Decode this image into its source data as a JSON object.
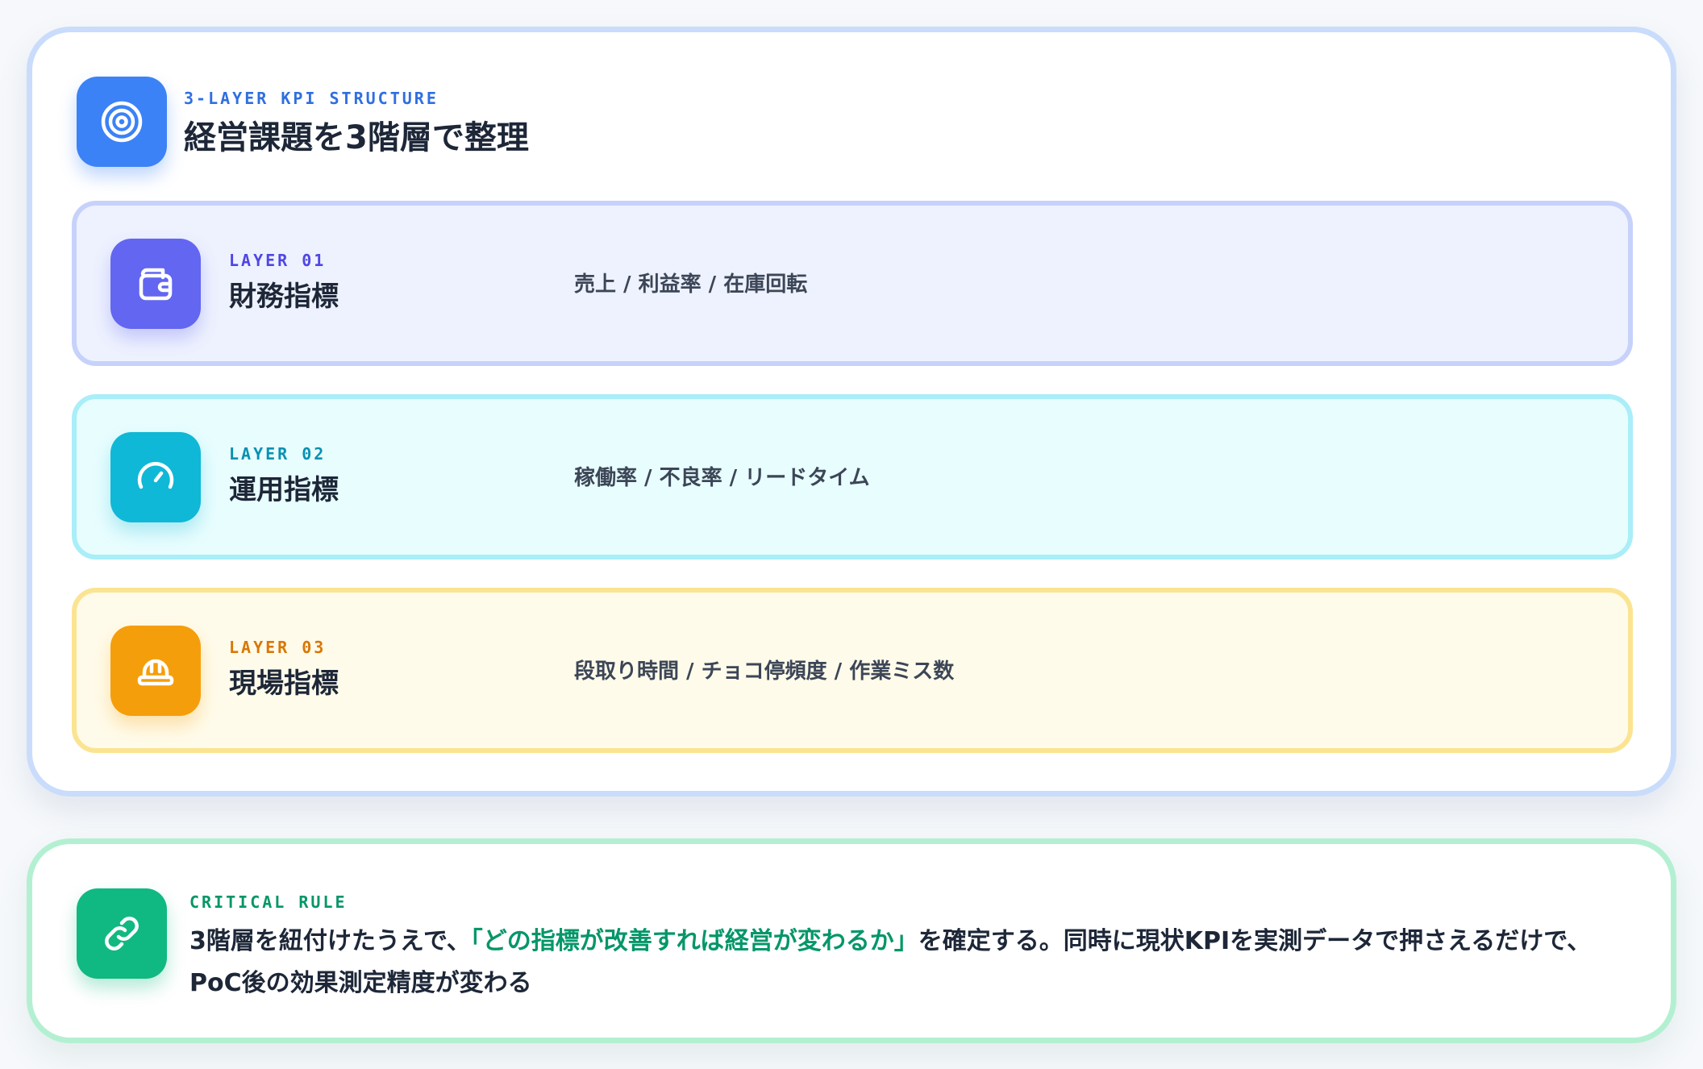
{
  "structure": {
    "eyebrow": "3-LAYER KPI STRUCTURE",
    "title": "経営課題を3階層で整理",
    "icon": "target-icon"
  },
  "layers": [
    {
      "eyebrow": "LAYER 01",
      "name": "財務指標",
      "metrics": "売上 / 利益率 / 在庫回転",
      "icon": "wallet-icon",
      "accent": "#6366f1"
    },
    {
      "eyebrow": "LAYER 02",
      "name": "運用指標",
      "metrics": "稼働率 / 不良率 / リードタイム",
      "icon": "gauge-icon",
      "accent": "#0fb8d6"
    },
    {
      "eyebrow": "LAYER 03",
      "name": "現場指標",
      "metrics": "段取り時間 / チョコ停頻度 / 作業ミス数",
      "icon": "hard-hat-icon",
      "accent": "#f59e0b"
    }
  ],
  "rule": {
    "eyebrow": "CRITICAL RULE",
    "icon": "link-icon",
    "text_before": "3階層を紐付けたうえで、",
    "text_highlight": "「どの指標が改善すれば経営が変わるか」",
    "text_after": "を確定する。同時に現状KPIを実測データで押さえるだけで、PoC後の効果測定精度が変わる",
    "highlight_color": "#059669"
  }
}
